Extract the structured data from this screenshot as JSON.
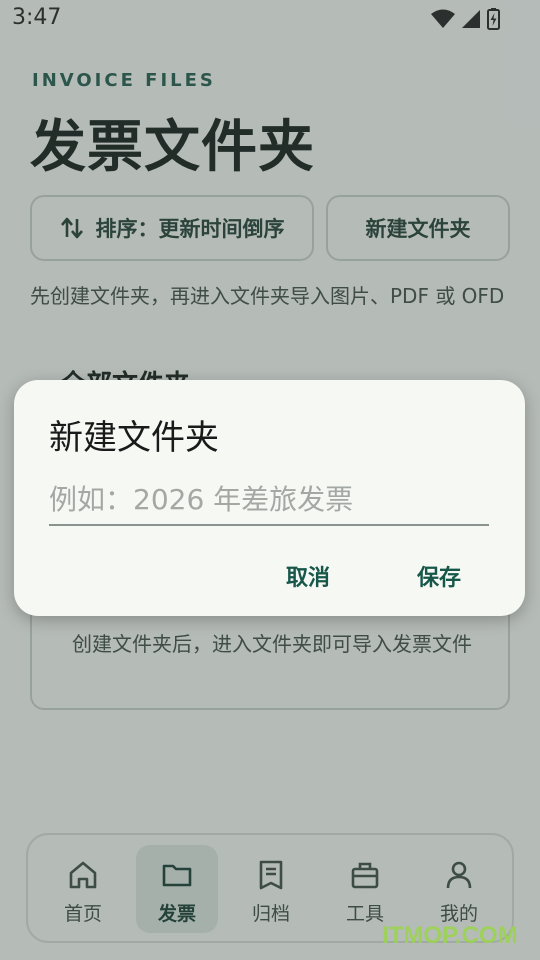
{
  "status": {
    "time": "3:47"
  },
  "header": {
    "eyebrow": "INVOICE FILES",
    "title": "发票文件夹"
  },
  "actions": {
    "sort_label": "排序：更新时间倒序",
    "new_folder_label": "新建文件夹"
  },
  "hint": "先创建文件夹，再进入文件夹导入图片、PDF 或 OFD",
  "section_heading": "全部文件夹",
  "empty_state": {
    "text": "创建文件夹后，进入文件夹即可导入发票文件"
  },
  "dialog": {
    "title": "新建文件夹",
    "input_value": "",
    "input_placeholder": "例如：2026 年差旅发票",
    "cancel_label": "取消",
    "save_label": "保存"
  },
  "nav": {
    "items": [
      {
        "label": "首页",
        "icon": "home-icon",
        "active": false
      },
      {
        "label": "发票",
        "icon": "folder-icon",
        "active": true
      },
      {
        "label": "归档",
        "icon": "archive-icon",
        "active": false
      },
      {
        "label": "工具",
        "icon": "toolbox-icon",
        "active": false
      },
      {
        "label": "我的",
        "icon": "person-icon",
        "active": false
      }
    ]
  },
  "watermark": "ITMOP.COM",
  "colors": {
    "accent": "#1e5a4c",
    "active_nav_bg": "#dbe7e1",
    "dialog_bg": "#f6f8f4"
  }
}
